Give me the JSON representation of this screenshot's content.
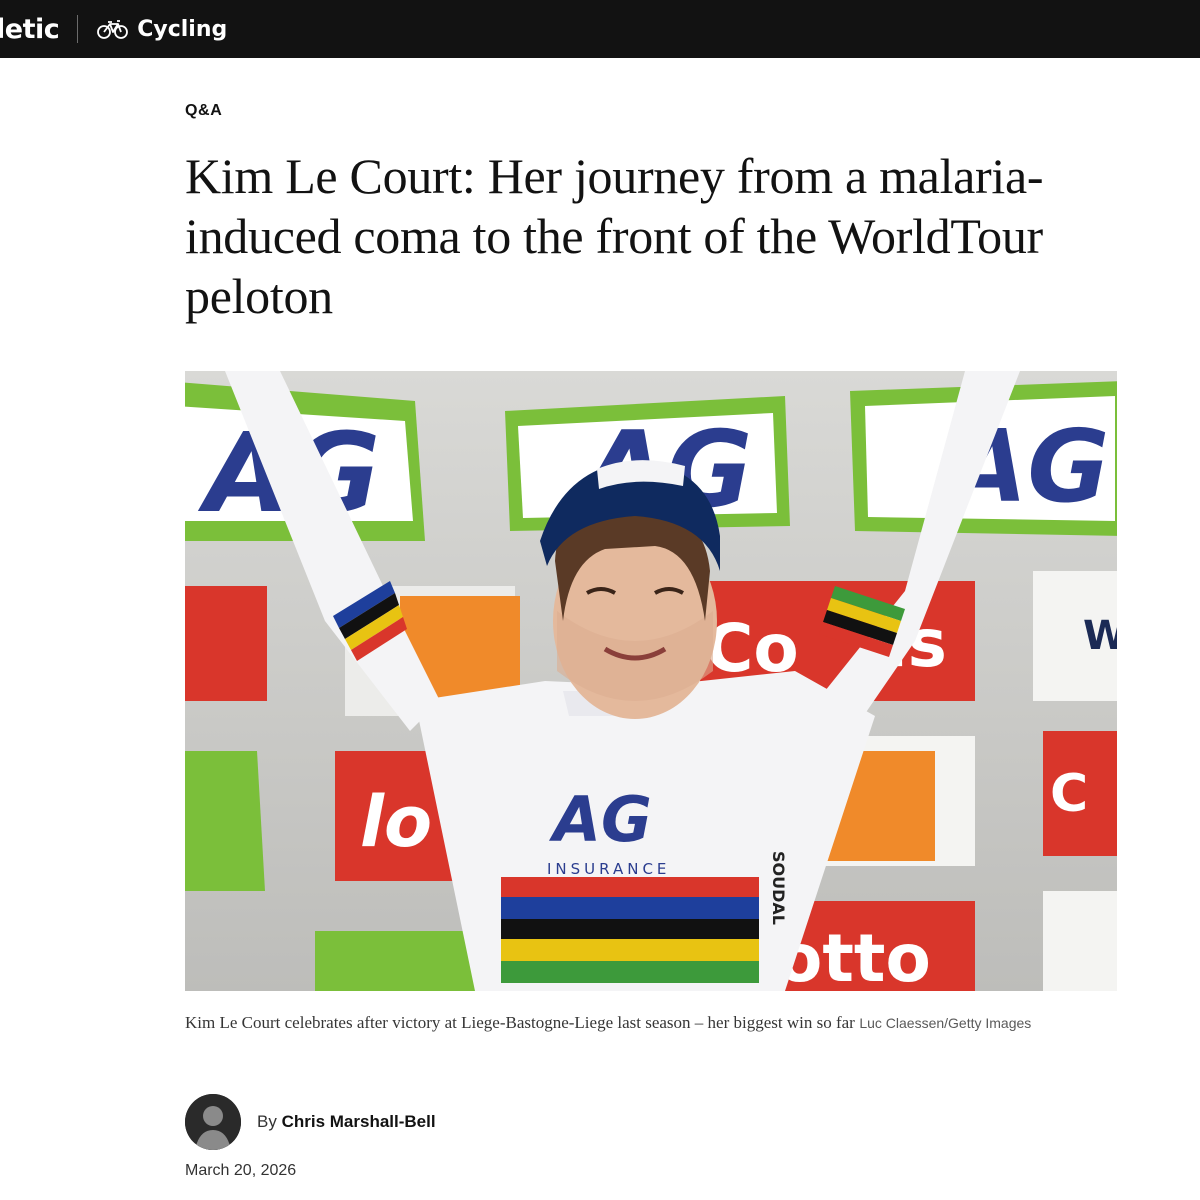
{
  "nav": {
    "brand": "letic",
    "section": "Cycling",
    "section_icon": "bicycle-icon"
  },
  "article": {
    "kicker": "Q&A",
    "headline": "Kim Le Court: Her journey from a malaria-induced coma to the front of the WorldTour peloton",
    "photo": {
      "caption": "Kim Le Court celebrates after victory at Liege-Bastogne-Liege last season – her biggest win so far",
      "credit": "Luc Claessen/Getty Images",
      "jersey_sponsor": "INSURANCE",
      "jersey_logo": "AG",
      "sleeve_sponsor": "SOUDAL",
      "board_logo": "AG",
      "board_words": [
        "Co",
        "is",
        "lo",
        "otto",
        "C",
        "W"
      ]
    },
    "byline_prefix": "By",
    "author": "Chris Marshall-Bell",
    "date": "March 20, 2026"
  },
  "colors": {
    "nav_bg": "#121212",
    "text": "#121212",
    "board_green": "#7bbf3a",
    "board_red": "#d9362b",
    "ag_blue": "#2b3d8f"
  }
}
